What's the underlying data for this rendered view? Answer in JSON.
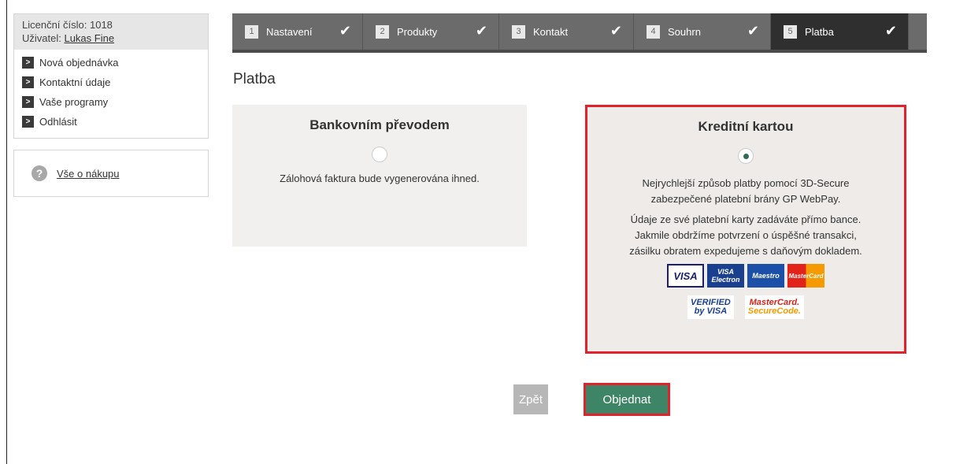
{
  "sidebar": {
    "license_label": "Licenční číslo: 1018",
    "user_prefix": "Uživatel: ",
    "user_name": "Lukas Fine",
    "menu": [
      {
        "label": "Nová objednávka"
      },
      {
        "label": "Kontaktní údaje"
      },
      {
        "label": "Vaše programy"
      },
      {
        "label": "Odhlásit"
      }
    ],
    "help_link": "Vše o nákupu"
  },
  "steps": [
    {
      "num": "1",
      "label": "Nastavení",
      "done": true
    },
    {
      "num": "2",
      "label": "Produkty",
      "done": true
    },
    {
      "num": "3",
      "label": "Kontakt",
      "done": true
    },
    {
      "num": "4",
      "label": "Souhrn",
      "done": true
    },
    {
      "num": "5",
      "label": "Platba",
      "done": true,
      "active": true
    }
  ],
  "page_title": "Platba",
  "payment": {
    "bank": {
      "title": "Bankovním převodem",
      "selected": false,
      "description": "Zálohová faktura bude vygenerována ihned."
    },
    "card": {
      "title": "Kreditní kartou",
      "selected": true,
      "description1_line1": "Nejrychlejší způsob platby pomocí 3D-Secure",
      "description1_line2": "zabezpečené platební brány GP WebPay.",
      "description2_line1": "Údaje ze své platební karty zadáváte přímo bance.",
      "description2_line2": "Jakmile obdržíme potvrzení o úspěšné transakci,",
      "description2_line3": "zásilku obratem expedujeme s daňovým dokladem.",
      "logos": {
        "visa": "VISA",
        "visa_electron_top": "VISA",
        "visa_electron_bottom": "Electron",
        "maestro": "Maestro",
        "mastercard": "MasterCard",
        "vbv_top": "VERIFIED",
        "vbv_bottom": "by VISA",
        "mcsc_top": "MasterCard.",
        "mcsc_bottom": "SecureCode."
      }
    }
  },
  "buttons": {
    "back": "Zpět",
    "order": "Objednat"
  },
  "colors": {
    "highlight": "#e3212d",
    "order_button": "#3e8466",
    "step_bar": "#6b6b6b",
    "step_active": "#2f2f2f"
  }
}
